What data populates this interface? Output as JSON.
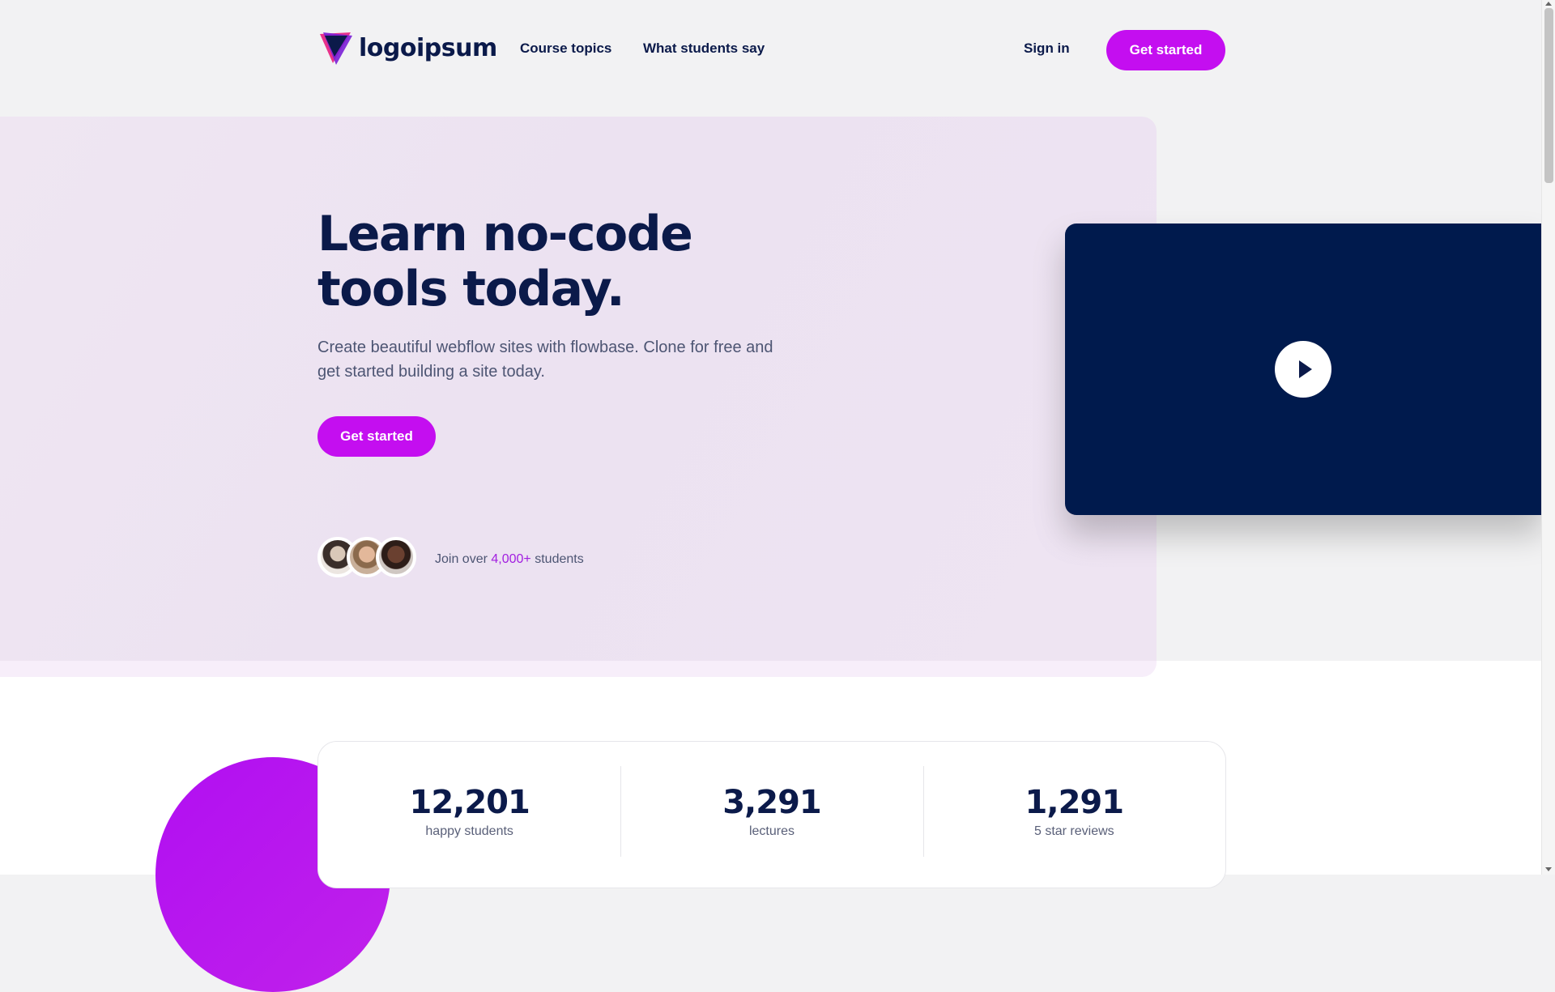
{
  "brand": {
    "name": "logoipsum",
    "accent": "#c40ef0",
    "navy": "#001a4d"
  },
  "nav": {
    "links": [
      "Course topics",
      "What students say"
    ],
    "signin": "Sign in",
    "cta": "Get started"
  },
  "hero": {
    "title_line1": "Learn no-code",
    "title_line2": "tools today.",
    "subtitle": "Create beautiful webflow sites with flowbase. Clone for free and get started building a site today.",
    "cta": "Get started",
    "social": {
      "prefix": "Join over",
      "count": "4,000+",
      "suffix": "students"
    }
  },
  "video": {
    "play_icon": "play-icon"
  },
  "stats": [
    {
      "value": "12,201",
      "label": "happy students"
    },
    {
      "value": "3,291",
      "label": "lectures"
    },
    {
      "value": "1,291",
      "label": "5 star reviews"
    }
  ]
}
